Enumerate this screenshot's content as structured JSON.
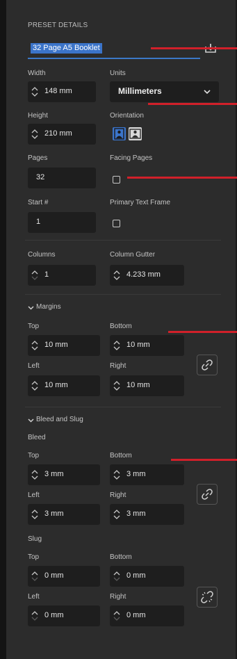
{
  "section_title": "PRESET DETAILS",
  "preset_name": "32 Page A5 Booklet",
  "labels": {
    "width": "Width",
    "units": "Units",
    "height": "Height",
    "orientation": "Orientation",
    "pages": "Pages",
    "facing_pages": "Facing Pages",
    "start": "Start #",
    "primary_text_frame": "Primary Text Frame",
    "columns": "Columns",
    "column_gutter": "Column Gutter"
  },
  "values": {
    "width": "148 mm",
    "units": "Millimeters",
    "height": "210 mm",
    "pages": "32",
    "start": "1",
    "columns": "1",
    "column_gutter": "4.233 mm"
  },
  "checkboxes": {
    "facing_pages": false,
    "primary_text_frame": false
  },
  "orientation": {
    "selected": "portrait",
    "options": [
      "portrait-icon",
      "landscape-icon"
    ]
  },
  "margins": {
    "title": "Margins",
    "top_label": "Top",
    "bottom_label": "Bottom",
    "left_label": "Left",
    "right_label": "Right",
    "top": "10 mm",
    "bottom": "10 mm",
    "left": "10 mm",
    "right": "10 mm",
    "link_icon": "link-icon"
  },
  "bleed_slug": {
    "title": "Bleed and Slug",
    "bleed_label": "Bleed",
    "top_label": "Top",
    "bottom_label": "Bottom",
    "left_label": "Left",
    "right_label": "Right",
    "bleed": {
      "top": "3 mm",
      "bottom": "3 mm",
      "left": "3 mm",
      "right": "3 mm",
      "link_icon": "link-icon"
    },
    "slug_label": "Slug",
    "slug": {
      "top": "0 mm",
      "bottom": "0 mm",
      "left": "0 mm",
      "right": "0 mm",
      "link_icon": "broken-link-icon"
    }
  },
  "colors": {
    "accent": "#3b74c9",
    "annotation": "#d1202a",
    "panel": "#2c2c2c",
    "field": "#1e1e1e"
  }
}
